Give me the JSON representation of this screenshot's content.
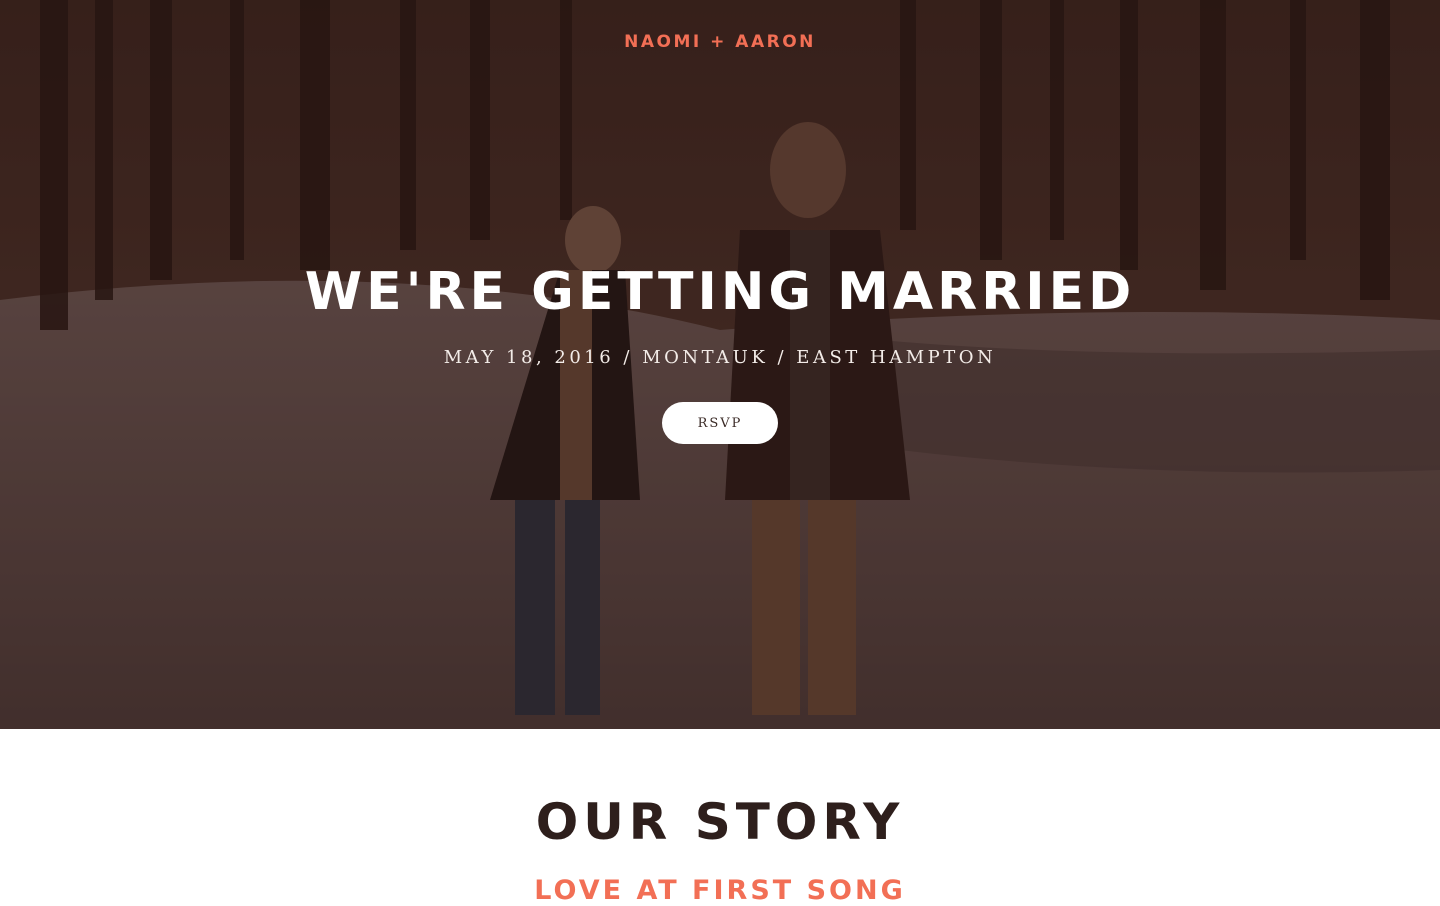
{
  "header": {
    "brand": "NAOMI + AARON"
  },
  "hero": {
    "headline": "WE'RE GETTING MARRIED",
    "details": "MAY 18, 2016 / MONTAUK / EAST HAMPTON",
    "rsvp_label": "RSVP",
    "background_image": "couple-walking-snowy-forest-photo"
  },
  "story": {
    "title": "OUR STORY",
    "subtitle": "LOVE AT FIRST SONG"
  },
  "colors": {
    "accent": "#f26f55",
    "dark_text": "#2e1f1c",
    "white": "#ffffff"
  }
}
